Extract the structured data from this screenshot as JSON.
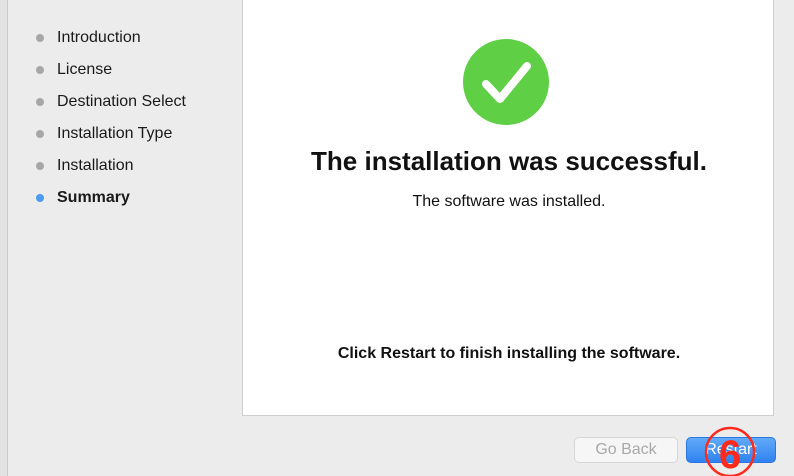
{
  "sidebar": {
    "steps": [
      {
        "label": "Introduction",
        "active": false
      },
      {
        "label": "License",
        "active": false
      },
      {
        "label": "Destination Select",
        "active": false
      },
      {
        "label": "Installation Type",
        "active": false
      },
      {
        "label": "Installation",
        "active": false
      },
      {
        "label": "Summary",
        "active": true
      }
    ]
  },
  "main": {
    "title": "The installation was successful.",
    "subtitle": "The software was installed.",
    "instruction": "Click Restart to finish installing the software."
  },
  "buttons": {
    "go_back": "Go Back",
    "restart": "Restart"
  },
  "annotation": {
    "number": "6"
  },
  "colors": {
    "success_green": "#5fcf45",
    "active_step_blue": "#4a9cf0",
    "inactive_step_gray": "#a6a6a6",
    "primary_button_blue": "#3a8ef3",
    "annotation_red": "#ff2a1a"
  },
  "icons": {
    "success": "checkmark-circle-icon"
  }
}
